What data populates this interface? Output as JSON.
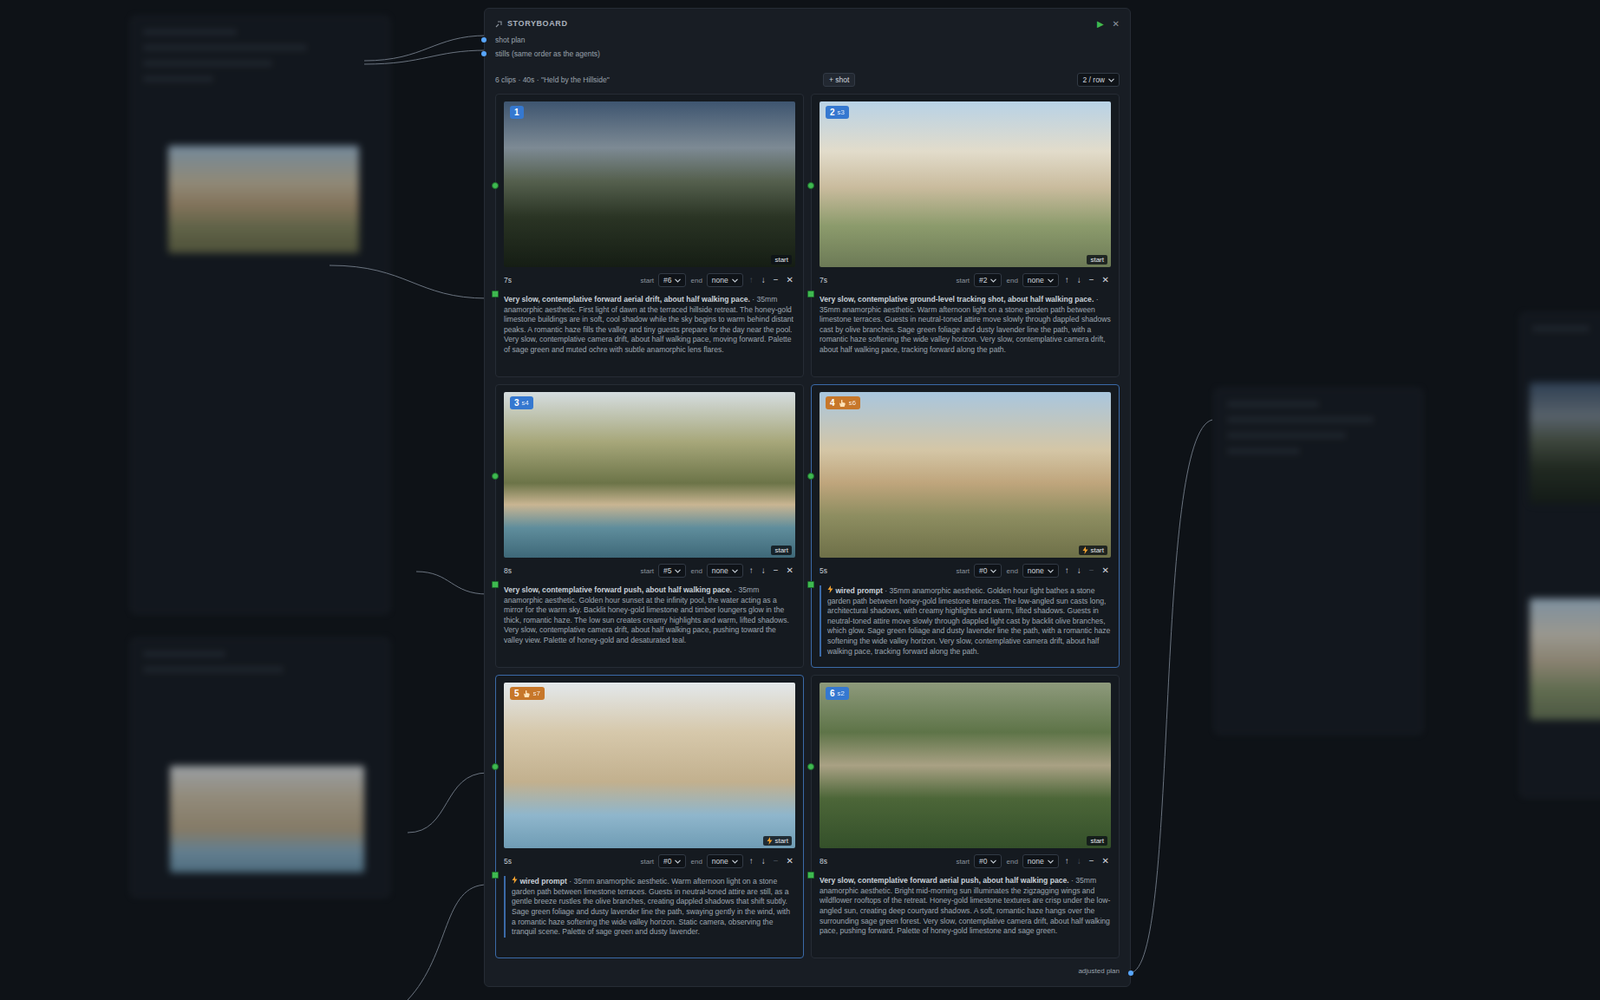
{
  "panel": {
    "title": "STORYBOARD",
    "actions": [
      {
        "label": "▶",
        "kind": "run"
      },
      {
        "label": "✕",
        "kind": "close"
      }
    ],
    "inputs": [
      "shot plan",
      "stills (same order as the agents)"
    ],
    "summary": "6 clips · 40s · \"Held by the Hillside\"",
    "add_button": "+ shot",
    "per_row": "2 / row",
    "output": "adjusted plan"
  },
  "cards": [
    {
      "number": "1",
      "sub": "",
      "wired": false,
      "tag": "start",
      "duration": "7s",
      "start_label": "start",
      "start": "#6",
      "end_label": "end",
      "end": "none",
      "buttons": [
        {
          "label": "↑",
          "disabled": true
        },
        {
          "label": "↓",
          "disabled": false
        },
        {
          "label": "−",
          "disabled": false
        },
        {
          "label": "✕",
          "disabled": false
        }
      ],
      "bold": "Very slow, contemplative forward aerial drift, about half walking pace.",
      "prompt": "· 35mm anamorphic aesthetic. First light of dawn at the terraced hillside retreat. The honey-gold limestone buildings are in soft, cool shadow while the sky begins to warm behind distant peaks. A romantic haze fills the valley and tiny guests prepare for the day near the pool. Very slow, contemplative camera drift, about half walking pace, moving forward. Palette of sage green and muted ochre with subtle anamorphic lens flares."
    },
    {
      "number": "2",
      "sub": "s3",
      "wired": false,
      "tag": "start",
      "duration": "7s",
      "start_label": "start",
      "start": "#2",
      "end_label": "end",
      "end": "none",
      "buttons": [
        {
          "label": "↑",
          "disabled": false
        },
        {
          "label": "↓",
          "disabled": false
        },
        {
          "label": "−",
          "disabled": false
        },
        {
          "label": "✕",
          "disabled": false
        }
      ],
      "bold": "Very slow, contemplative ground-level tracking shot, about half walking pace.",
      "prompt": "· 35mm anamorphic aesthetic. Warm afternoon light on a stone garden path between limestone terraces. Guests in neutral-toned attire move slowly through dappled shadows cast by olive branches. Sage green foliage and dusty lavender line the path, with a romantic haze softening the wide valley horizon. Very slow, contemplative camera drift, about half walking pace, tracking forward along the path."
    },
    {
      "number": "3",
      "sub": "s4",
      "wired": false,
      "tag": "start",
      "duration": "8s",
      "start_label": "start",
      "start": "#5",
      "end_label": "end",
      "end": "none",
      "buttons": [
        {
          "label": "↑",
          "disabled": false
        },
        {
          "label": "↓",
          "disabled": false
        },
        {
          "label": "−",
          "disabled": false
        },
        {
          "label": "✕",
          "disabled": false
        }
      ],
      "bold": "Very slow, contemplative forward push, about half walking pace.",
      "prompt": "· 35mm anamorphic aesthetic. Golden hour sunset at the infinity pool, the water acting as a mirror for the warm sky. Backlit honey-gold limestone and timber loungers glow in the thick, romantic haze. The low sun creates creamy highlights and warm, lifted shadows. Very slow, contemplative camera drift, about half walking pace, pushing toward the valley view. Palette of honey-gold and desaturated teal."
    },
    {
      "number": "4",
      "sub": "s6",
      "wired": true,
      "tag": "start",
      "duration": "5s",
      "start_label": "start",
      "start": "#0",
      "end_label": "end",
      "end": "none",
      "buttons": [
        {
          "label": "↑",
          "disabled": false
        },
        {
          "label": "↓",
          "disabled": false
        },
        {
          "label": "−",
          "disabled": true
        },
        {
          "label": "✕",
          "disabled": false
        }
      ],
      "bold": "wired prompt",
      "prompt": "· 35mm anamorphic aesthetic. Golden hour light bathes a stone garden path between honey-gold limestone terraces. The low-angled sun casts long, architectural shadows, with creamy highlights and warm, lifted shadows. Guests in neutral-toned attire move slowly through dappled light cast by backlit olive branches, which glow. Sage green foliage and dusty lavender line the path, with a romantic haze softening the wide valley horizon. Very slow, contemplative camera drift, about half walking pace, tracking forward along the path."
    },
    {
      "number": "5",
      "sub": "s7",
      "wired": true,
      "tag": "start",
      "duration": "5s",
      "start_label": "start",
      "start": "#0",
      "end_label": "end",
      "end": "none",
      "buttons": [
        {
          "label": "↑",
          "disabled": false
        },
        {
          "label": "↓",
          "disabled": false
        },
        {
          "label": "−",
          "disabled": true
        },
        {
          "label": "✕",
          "disabled": false
        }
      ],
      "bold": "wired prompt",
      "prompt": "· 35mm anamorphic aesthetic. Warm afternoon light on a stone garden path between limestone terraces. Guests in neutral-toned attire are still, as a gentle breeze rustles the olive branches, creating dappled shadows that shift subtly. Sage green foliage and dusty lavender line the path, swaying gently in the wind, with a romantic haze softening the wide valley horizon. Static camera, observing the tranquil scene. Palette of sage green and dusty lavender."
    },
    {
      "number": "6",
      "sub": "s2",
      "wired": false,
      "tag": "start",
      "duration": "8s",
      "start_label": "start",
      "start": "#0",
      "end_label": "end",
      "end": "none",
      "buttons": [
        {
          "label": "↑",
          "disabled": false
        },
        {
          "label": "↓",
          "disabled": true
        },
        {
          "label": "−",
          "disabled": false
        },
        {
          "label": "✕",
          "disabled": false
        }
      ],
      "bold": "Very slow, contemplative forward aerial push, about half walking pace.",
      "prompt": "· 35mm anamorphic aesthetic. Bright mid-morning sun illuminates the zigzagging wings and wildflower rooftops of the retreat. Honey-gold limestone textures are crisp under the low-angled sun, creating deep courtyard shadows. A soft, romantic haze hangs over the surrounding sage green forest. Very slow, contemplative camera drift, about half walking pace, pushing forward. Palette of honey-gold limestone and sage green."
    }
  ]
}
